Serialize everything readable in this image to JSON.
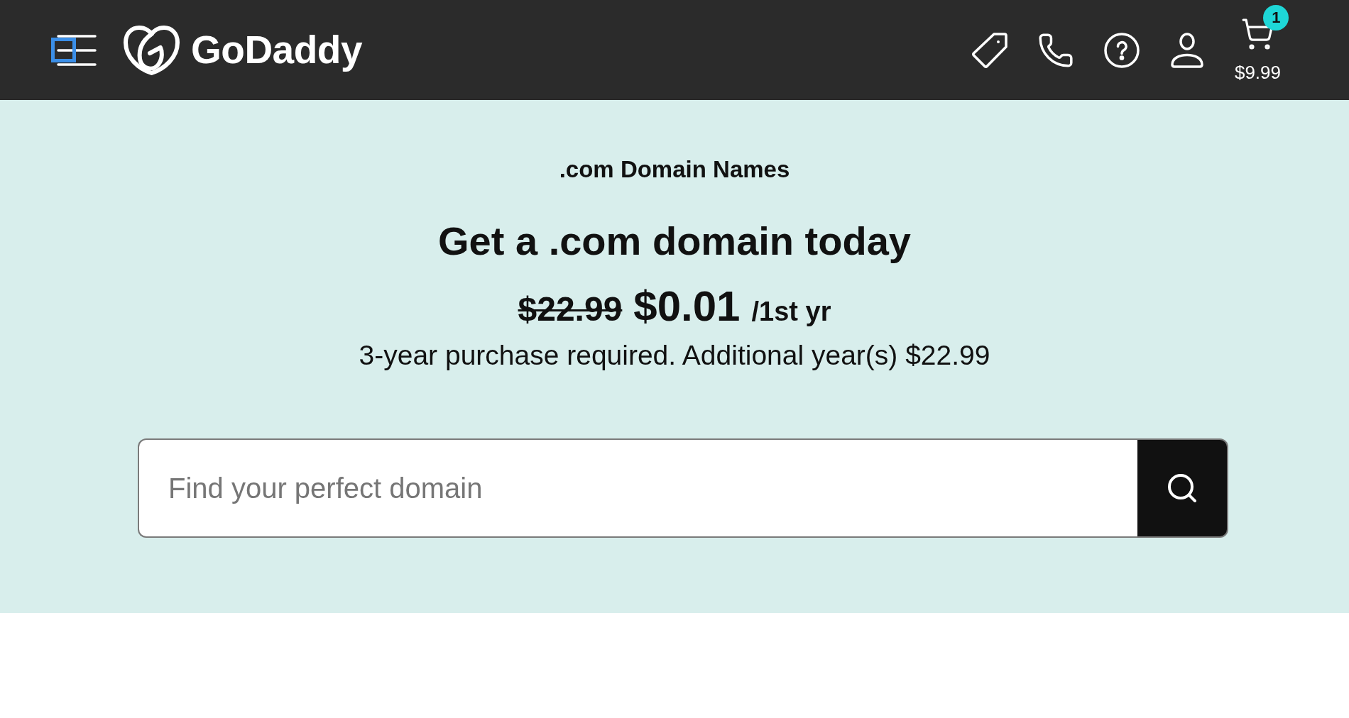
{
  "header": {
    "menu_button": {
      "focused": true
    },
    "logo": {
      "wordmark": "GoDaddy"
    },
    "cart": {
      "count": "1",
      "total": "$9.99"
    }
  },
  "hero": {
    "eyebrow": ".com Domain Names",
    "title": "Get a .com domain today",
    "price": {
      "original": "$22.99",
      "current": "$0.01",
      "term": "/1st yr"
    },
    "terms": "3-year purchase required. Additional year(s) $22.99",
    "search": {
      "placeholder": "Find your perfect domain"
    }
  }
}
